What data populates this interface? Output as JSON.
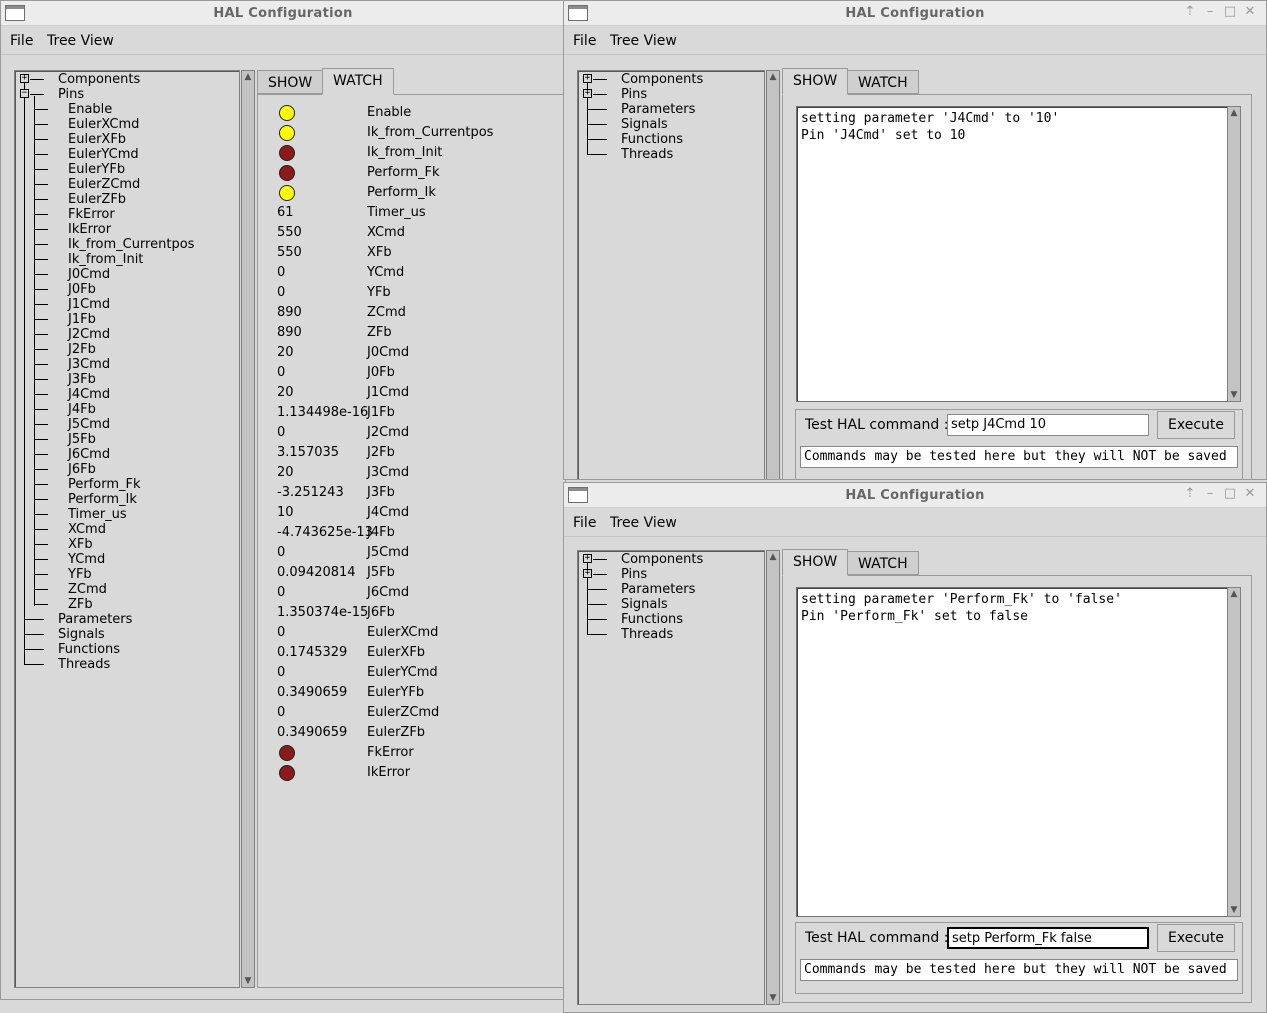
{
  "window_title": "HAL Configuration",
  "menu": {
    "file": "File",
    "tree_view": "Tree View"
  },
  "tabs": {
    "show": "SHOW",
    "watch": "WATCH"
  },
  "left": {
    "tree_top": [
      "Components",
      "Pins"
    ],
    "pins": [
      "Enable",
      "EulerXCmd",
      "EulerXFb",
      "EulerYCmd",
      "EulerYFb",
      "EulerZCmd",
      "EulerZFb",
      "FkError",
      "IkError",
      "Ik_from_Currentpos",
      "Ik_from_Init",
      "J0Cmd",
      "J0Fb",
      "J1Cmd",
      "J1Fb",
      "J2Cmd",
      "J2Fb",
      "J3Cmd",
      "J3Fb",
      "J4Cmd",
      "J4Fb",
      "J5Cmd",
      "J5Fb",
      "J6Cmd",
      "J6Fb",
      "Perform_Fk",
      "Perform_Ik",
      "Timer_us",
      "XCmd",
      "XFb",
      "YCmd",
      "YFb",
      "ZCmd",
      "ZFb"
    ],
    "tree_bottom": [
      "Parameters",
      "Signals",
      "Functions",
      "Threads"
    ],
    "watch": [
      {
        "led": "on",
        "name": "Enable"
      },
      {
        "led": "on",
        "name": "Ik_from_Currentpos"
      },
      {
        "led": "off",
        "name": "Ik_from_Init"
      },
      {
        "led": "off",
        "name": "Perform_Fk"
      },
      {
        "led": "on",
        "name": "Perform_Ik"
      },
      {
        "value": "61",
        "name": "Timer_us"
      },
      {
        "value": "550",
        "name": "XCmd"
      },
      {
        "value": "550",
        "name": "XFb"
      },
      {
        "value": "0",
        "name": "YCmd"
      },
      {
        "value": "0",
        "name": "YFb"
      },
      {
        "value": "890",
        "name": "ZCmd"
      },
      {
        "value": "890",
        "name": "ZFb"
      },
      {
        "value": "20",
        "name": "J0Cmd"
      },
      {
        "value": "0",
        "name": "J0Fb"
      },
      {
        "value": "20",
        "name": "J1Cmd"
      },
      {
        "value": "1.134498e-16",
        "name": "J1Fb"
      },
      {
        "value": "0",
        "name": "J2Cmd"
      },
      {
        "value": "3.157035",
        "name": "J2Fb"
      },
      {
        "value": "20",
        "name": "J3Cmd"
      },
      {
        "value": "-3.251243",
        "name": "J3Fb"
      },
      {
        "value": "10",
        "name": "J4Cmd"
      },
      {
        "value": "-4.743625e-13",
        "name": "J4Fb"
      },
      {
        "value": "0",
        "name": "J5Cmd"
      },
      {
        "value": "0.09420814",
        "name": "J5Fb"
      },
      {
        "value": "0",
        "name": "J6Cmd"
      },
      {
        "value": "1.350374e-15",
        "name": "J6Fb"
      },
      {
        "value": "0",
        "name": "EulerXCmd"
      },
      {
        "value": "0.1745329",
        "name": "EulerXFb"
      },
      {
        "value": "0",
        "name": "EulerYCmd"
      },
      {
        "value": "0.3490659",
        "name": "EulerYFb"
      },
      {
        "value": "0",
        "name": "EulerZCmd"
      },
      {
        "value": "0.3490659",
        "name": "EulerZFb"
      },
      {
        "led": "off",
        "name": "FkError"
      },
      {
        "led": "off",
        "name": "IkError"
      }
    ]
  },
  "small_tree": [
    "Components",
    "Pins",
    "Parameters",
    "Signals",
    "Functions",
    "Threads"
  ],
  "top_right": {
    "output": "setting parameter 'J4Cmd' to '10'\nPin 'J4Cmd' set to 10",
    "cmd_label": "Test HAL command :",
    "cmd_value": "setp J4Cmd 10",
    "execute": "Execute",
    "note": "Commands may be tested here but they will NOT be saved"
  },
  "bottom_right": {
    "output": "setting parameter 'Perform_Fk' to 'false'\nPin 'Perform_Fk' set to false",
    "cmd_label": "Test HAL command :",
    "cmd_value": "setp Perform_Fk false",
    "execute": "Execute",
    "note": "Commands may be tested here but they will NOT be saved"
  },
  "colors": {
    "led_on": "#ffff00",
    "led_off": "#8b1a1a"
  }
}
